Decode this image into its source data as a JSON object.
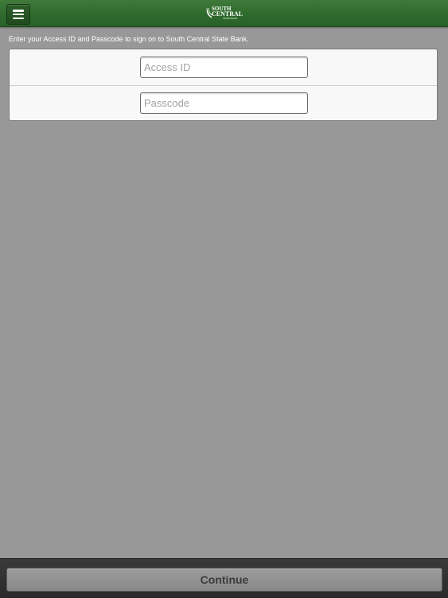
{
  "header": {
    "menu_icon": "hamburger-menu-icon",
    "logo": {
      "icon": "leaf-icon",
      "line1": "SOUTH",
      "line2": "CENTRAL",
      "line3": "STATE BANK"
    },
    "bar_color": "#2f6b2d"
  },
  "login": {
    "instruction": "Enter your Access ID and Passcode to sign on to South Central State Bank.",
    "access_id": {
      "value": "",
      "placeholder": "Access ID"
    },
    "passcode": {
      "value": "",
      "placeholder": "Passcode"
    }
  },
  "footer": {
    "continue_label": "Continue"
  },
  "colors": {
    "background": "#989898",
    "panel": "#f8f8f8",
    "bottom_bar": "#2f2f2f"
  }
}
